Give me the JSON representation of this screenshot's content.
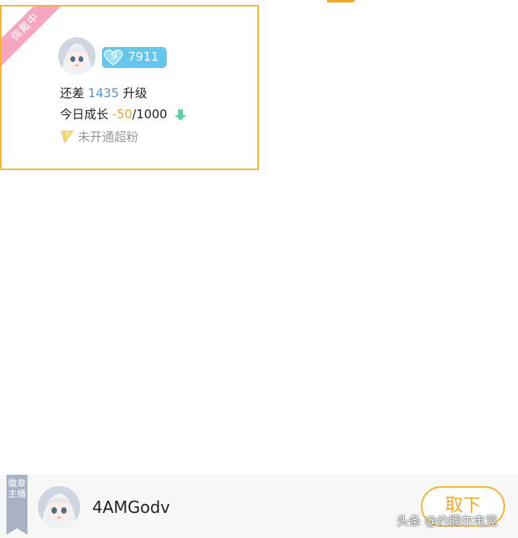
{
  "badge_card": {
    "ribbon": "佩戴中",
    "level": "9",
    "intimacy": "7911",
    "upgrade_prefix": "还差",
    "upgrade_value": "1435",
    "upgrade_suffix": "升级",
    "growth_prefix": "今日成长",
    "growth_value": "-50",
    "growth_total": "/1000",
    "fans_status": "未开通超粉",
    "accent_color": "#f5b731"
  },
  "bottom_bar": {
    "side_tag": "徽章主播",
    "anchor_name": "4AMGodv",
    "take_off_label": "取下"
  },
  "watermark": "头条 @约髑尔电竞"
}
